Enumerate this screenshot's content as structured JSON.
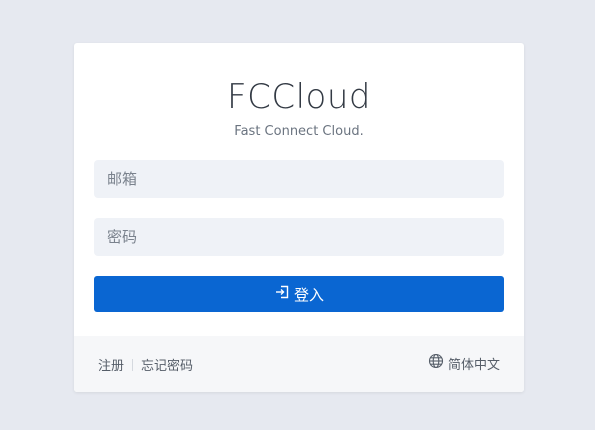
{
  "brand": {
    "title": "FCCloud",
    "subtitle": "Fast Connect Cloud."
  },
  "form": {
    "email_placeholder": "邮箱",
    "password_placeholder": "密码",
    "login_label": "登入",
    "login_icon": "login-icon"
  },
  "footer": {
    "register_label": "注册",
    "forgot_label": "忘记密码",
    "language_label": "简体中文",
    "language_icon": "globe-icon"
  },
  "colors": {
    "background": "#e6e9f0",
    "primary": "#0a66d2",
    "input_bg": "#eff2f7"
  }
}
